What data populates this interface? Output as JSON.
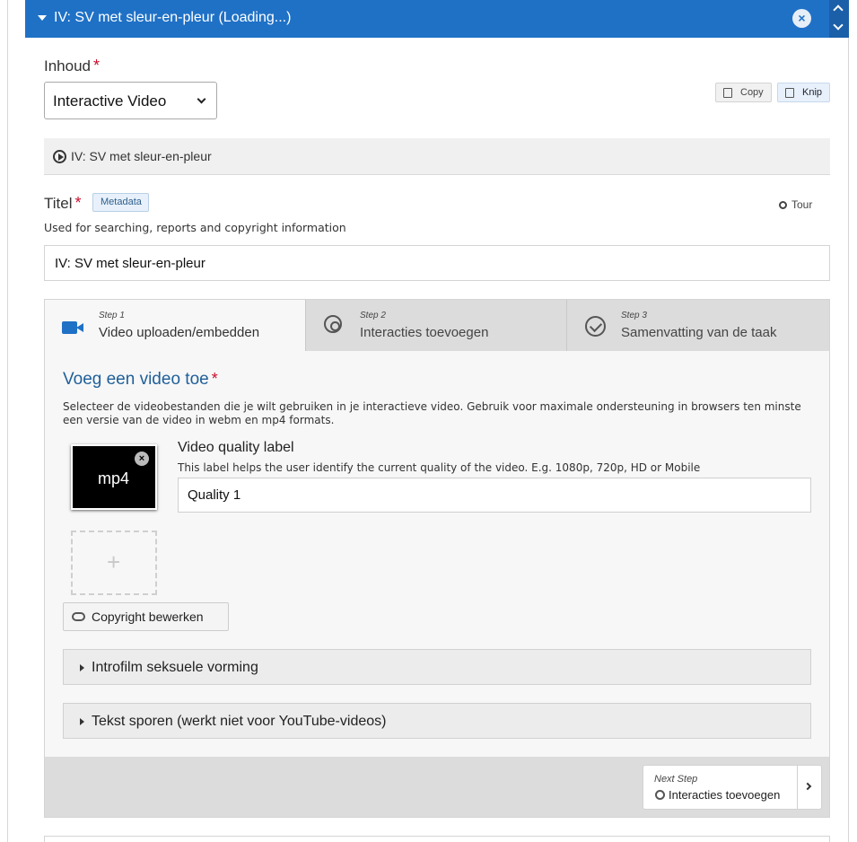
{
  "header": {
    "title": "IV: SV met sleur-en-pleur (Loading...)"
  },
  "inhoud": {
    "label": "Inhoud",
    "required": "*",
    "selected": "Interactive Video"
  },
  "clipboard": {
    "copy_label": "Copy",
    "cut_label": "Knip"
  },
  "content_header": {
    "title": "IV: SV met sleur-en-pleur"
  },
  "titel": {
    "label": "Titel",
    "required": "*",
    "metadata_label": "Metadata",
    "tour_label": "Tour",
    "description": "Used for searching, reports and copyright information",
    "value": "IV: SV met sleur-en-pleur"
  },
  "wizard": {
    "steps": [
      {
        "step": "Step 1",
        "name": "Video uploaden/embedden"
      },
      {
        "step": "Step 2",
        "name": "Interacties toevoegen"
      },
      {
        "step": "Step 3",
        "name": "Samenvatting van de taak"
      }
    ],
    "section_title": "Voeg een video toe",
    "required": "*",
    "section_desc": "Selecteer de videobestanden die je wilt gebruiken in je interactieve video. Gebruik voor maximale ondersteuning in browsers ten minste een versie van de video in webm en mp4 formats.",
    "video_file": {
      "format": "mp4",
      "remove": "×"
    },
    "quality": {
      "label": "Video quality label",
      "description": "This label helps the user identify the current quality of the video. E.g. 1080p, 720p, HD or Mobile",
      "value": "Quality 1"
    },
    "add_symbol": "+",
    "copyright_button": "Copyright bewerken",
    "collapsibles": [
      "Introfilm seksuele vorming",
      "Tekst sporen (werkt niet voor YouTube-videos)"
    ],
    "next_step": {
      "label": "Next Step",
      "target": "Interacties toevoegen"
    }
  }
}
